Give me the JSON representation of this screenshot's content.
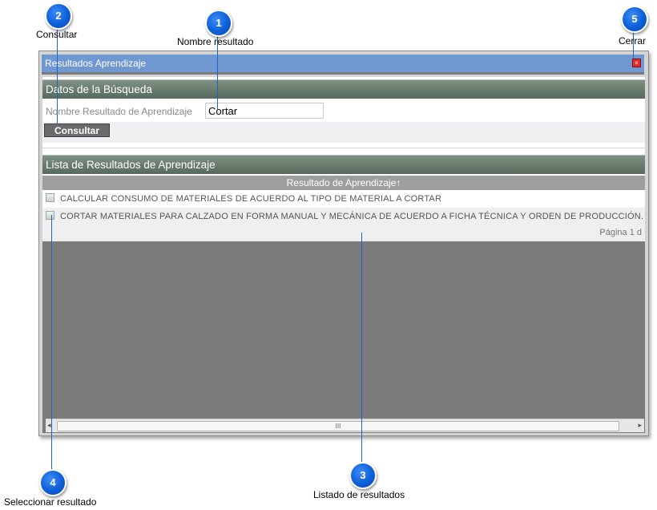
{
  "callouts": {
    "c1": {
      "number": "1",
      "label": "Nombre resultado"
    },
    "c2": {
      "number": "2",
      "label": "Consultar"
    },
    "c3": {
      "number": "3",
      "label": "Listado de resultados"
    },
    "c4": {
      "number": "4",
      "label": "Seleccionar resultado"
    },
    "c5": {
      "number": "5",
      "label": "Cerrar"
    }
  },
  "dialog": {
    "title": "Resultados Aprendizaje",
    "close_glyph": "×"
  },
  "search": {
    "header": "Datos de la Búsqueda",
    "field_label": "Nombre Resultado de Aprendizaje",
    "field_value": "Cortar",
    "button_label": "Consultar"
  },
  "results": {
    "header": "Lista de Resultados de Aprendizaje",
    "column_header": "Resultado de Aprendizaje↑",
    "rows": [
      {
        "text": "CALCULAR CONSUMO DE MATERIALES DE ACUERDO AL TIPO DE MATERIAL A CORTAR",
        "icon": "edit-select-icon"
      },
      {
        "text": "CORTAR MATERIALES PARA CALZADO EN FORMA MANUAL Y MECÁNICA DE ACUERDO A FICHA TÉCNICA Y ORDEN DE PRODUCCIÓN.",
        "icon": "edit-select-icon"
      }
    ],
    "pager": "Página 1 d"
  },
  "scrollbar": {
    "left": "◂",
    "right": "▸",
    "grip": "III"
  },
  "colors": {
    "titlebar": "#6e98cf",
    "section": "#5f7466",
    "callout": "#0d5fd8"
  }
}
